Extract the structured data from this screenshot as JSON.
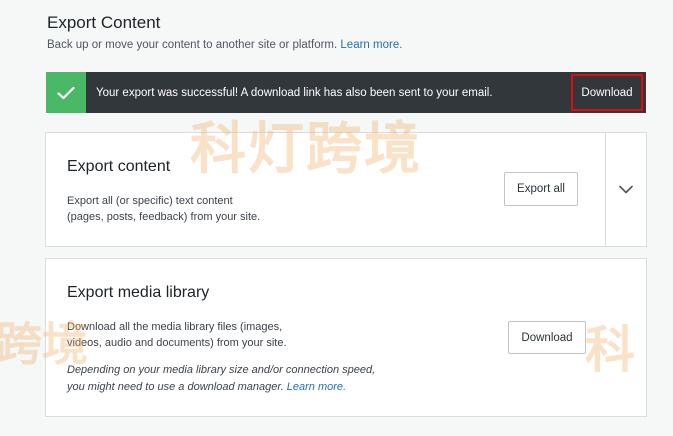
{
  "header": {
    "title": "Export Content",
    "description": "Back up or move your content to another site or platform. ",
    "learn_more": "Learn more."
  },
  "notice": {
    "icon": "checkmark-icon",
    "message": "Your export was successful! A download link has also been sent to your email.",
    "download_label": "Download",
    "colors": {
      "bar": "#32373c",
      "icon_bg": "#4ab866",
      "highlight": "#e00b0b"
    }
  },
  "export_content": {
    "title": "Export content",
    "description_line1": "Export all (or specific) text content",
    "description_line2": "(pages, posts, feedback) from your site.",
    "button_label": "Export all",
    "expand_icon": "chevron-down-icon"
  },
  "export_media": {
    "title": "Export media library",
    "description_line1": "Download all the media library files (images,",
    "description_line2": "videos, audio and documents) from your site.",
    "note_line1": "Depending on your media library size and/or connection speed,",
    "note_line2": "you might need to use a download manager. ",
    "note_link": "Learn more.",
    "button_label": "Download"
  },
  "watermark": {
    "main": "科灯跨境",
    "left": "跨境",
    "right": "科"
  }
}
